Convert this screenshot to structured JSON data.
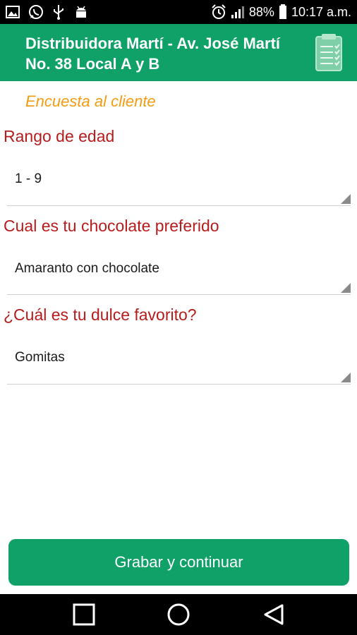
{
  "status_bar": {
    "battery": "88%",
    "time": "10:17 a.m.",
    "icons": [
      "image-icon",
      "whatsapp-icon",
      "usb-icon",
      "android-icon",
      "alarm-icon",
      "signal-icon",
      "battery-icon"
    ]
  },
  "app_bar": {
    "title": "Distribuidora Martí - Av. José Martí No. 38 Local A y B",
    "icon": "checklist-icon"
  },
  "survey": {
    "title": "Encuesta al cliente",
    "questions": [
      {
        "label": "Rango de edad",
        "value": "1 - 9"
      },
      {
        "label": "Cual es tu chocolate preferido",
        "value": "Amaranto con chocolate"
      },
      {
        "label": "¿Cuál es tu dulce favorito?",
        "value": "Gomitas"
      }
    ]
  },
  "actions": {
    "save_label": "Grabar y continuar"
  },
  "nav": {
    "icons": [
      "recents-square-icon",
      "home-circle-icon",
      "back-triangle-icon"
    ]
  },
  "colors": {
    "primary": "#0fa168",
    "accent_orange": "#f39c12",
    "question_red": "#b71c1c"
  }
}
